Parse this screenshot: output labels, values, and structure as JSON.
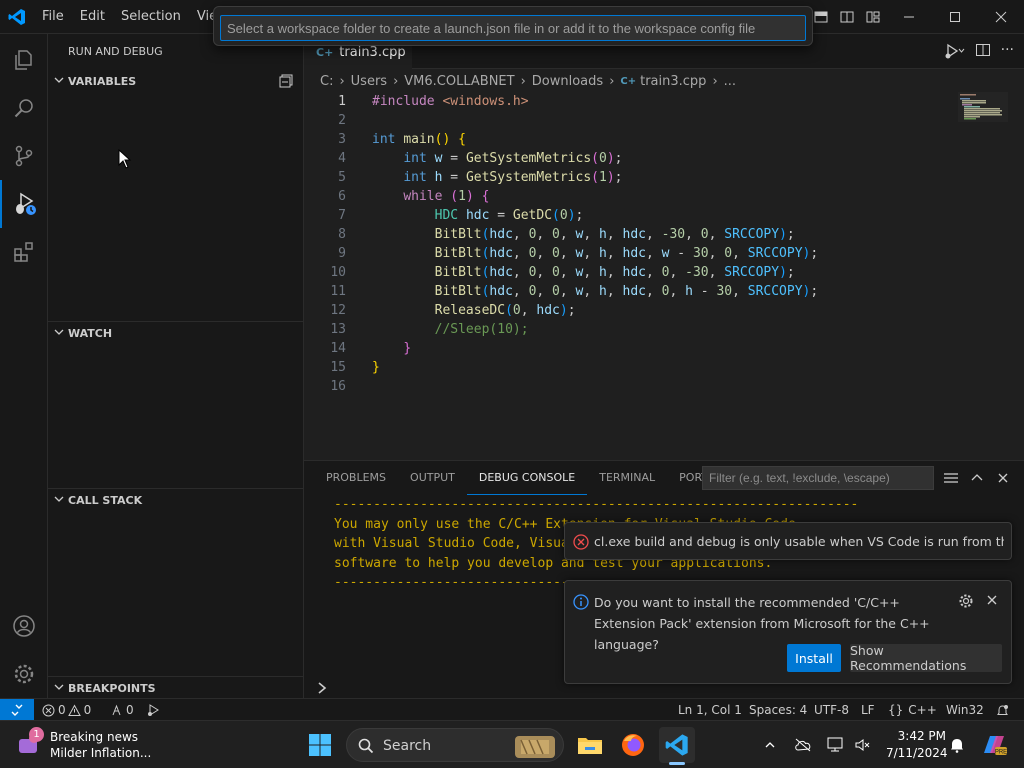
{
  "title_menu": [
    "File",
    "Edit",
    "Selection",
    "View"
  ],
  "quick_pick": {
    "placeholder": "Select a workspace folder to create a launch.json file in or add it to the workspace config file"
  },
  "sidebar": {
    "title": "RUN AND DEBUG",
    "sections": {
      "variables": "VARIABLES",
      "watch": "WATCH",
      "call_stack": "CALL STACK",
      "breakpoints": "BREAKPOINTS"
    }
  },
  "editor": {
    "tab_name": "train3.cpp",
    "breadcrumb": [
      "C:",
      "Users",
      "VM6.COLLABNET",
      "Downloads",
      "train3.cpp",
      "..."
    ]
  },
  "code_lines": [
    "#include <windows.h>",
    "",
    "int main() {",
    "    int w = GetSystemMetrics(0);",
    "    int h = GetSystemMetrics(1);",
    "    while (1) {",
    "        HDC hdc = GetDC(0);",
    "        BitBlt(hdc, 0, 0, w, h, hdc, -30, 0, SRCCOPY);",
    "        BitBlt(hdc, 0, 0, w, h, hdc, w - 30, 0, SRCCOPY);",
    "        BitBlt(hdc, 0, 0, w, h, hdc, 0, -30, SRCCOPY);",
    "        BitBlt(hdc, 0, 0, w, h, hdc, 0, h - 30, SRCCOPY);",
    "        ReleaseDC(0, hdc);",
    "        //Sleep(10);",
    "    }",
    "}",
    ""
  ],
  "panel": {
    "tabs": [
      "PROBLEMS",
      "OUTPUT",
      "DEBUG CONSOLE",
      "TERMINAL",
      "PORTS"
    ],
    "filter_placeholder": "Filter (e.g. text, !exclude, \\escape)",
    "console_lines": [
      "-------------------------------------------------------------------",
      "You may only use the C/C++ Extension for Visual Studio Code",
      "with Visual Studio Code, Visual Studio or Visual Studio for Mac",
      "software to help you develop and test your applications.",
      "-------------------------------------------------------------------"
    ]
  },
  "notifications": {
    "error_message": "cl.exe build and debug is only usable when VS Code is run from the D...",
    "info_message": "Do you want to install the recommended 'C/C++ Extension Pack' extension from Microsoft for the C++ language?",
    "install_label": "Install",
    "show_recommendations_label": "Show Recommendations"
  },
  "status_bar": {
    "errors": "0",
    "warnings": "0",
    "ports": "0",
    "position": "Ln 1, Col 1",
    "spaces": "Spaces: 4",
    "encoding": "UTF-8",
    "eol": "LF",
    "language": "C++",
    "platform": "Win32"
  },
  "taskbar": {
    "news_badge": "1",
    "news_title": "Breaking news",
    "news_subtitle": "Milder Inflation...",
    "search_label": "Search",
    "time": "3:42 PM",
    "date": "7/11/2024"
  },
  "colors": {
    "accent": "#0078d4",
    "background": "#1f1f1f",
    "console_text": "#cca700",
    "error": "#f14c4c",
    "info": "#3794ff"
  },
  "icons": [
    "vscode-logo",
    "explorer-icon",
    "search-icon",
    "source-control-icon",
    "run-debug-icon",
    "extensions-icon",
    "account-icon",
    "manage-gear-icon"
  ]
}
